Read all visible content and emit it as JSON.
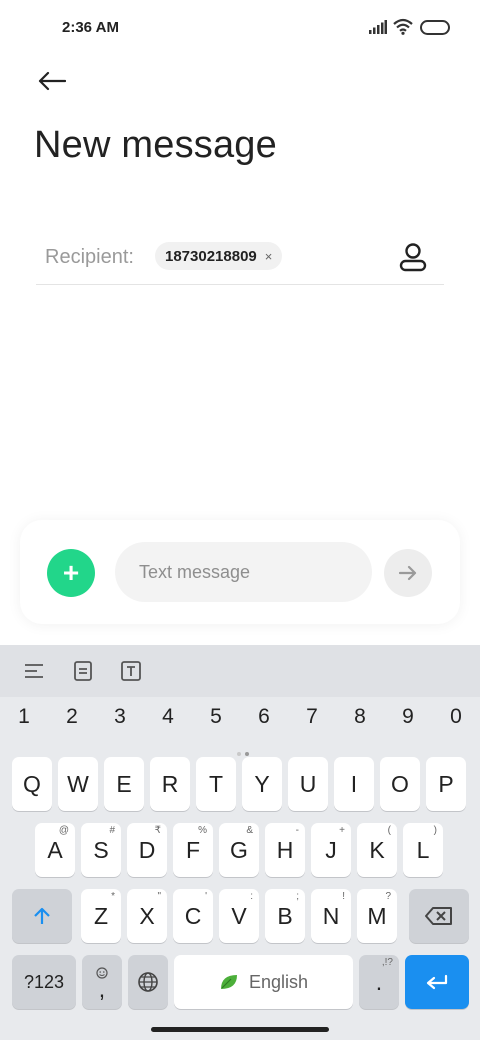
{
  "status_bar": {
    "time": "2:36 AM"
  },
  "header": {
    "title": "New message"
  },
  "recipient": {
    "label": "Recipient:",
    "chip_text": "18730218809",
    "chip_close": "×"
  },
  "compose": {
    "placeholder": "Text message",
    "attach_symbol": "+"
  },
  "keyboard": {
    "numbers": [
      "1",
      "2",
      "3",
      "4",
      "5",
      "6",
      "7",
      "8",
      "9",
      "0"
    ],
    "row1": [
      "Q",
      "W",
      "E",
      "R",
      "T",
      "Y",
      "U",
      "I",
      "O",
      "P"
    ],
    "row2": [
      "A",
      "S",
      "D",
      "F",
      "G",
      "H",
      "J",
      "K",
      "L"
    ],
    "row2_hints": [
      "@",
      "#",
      "₹",
      "%",
      "&",
      "-",
      "+",
      "(",
      ")"
    ],
    "row3": [
      "Z",
      "X",
      "C",
      "V",
      "B",
      "N",
      "M"
    ],
    "row3_hints": [
      "*",
      "\"",
      "'",
      ":",
      ";",
      "!",
      "?"
    ],
    "symbols_key": "?123",
    "comma_key": ",",
    "space_label": "English",
    "period_key": ".",
    "period_hint": ",!?"
  },
  "colors": {
    "accent_green": "#22d68a",
    "enter_blue": "#1a8ff0"
  }
}
